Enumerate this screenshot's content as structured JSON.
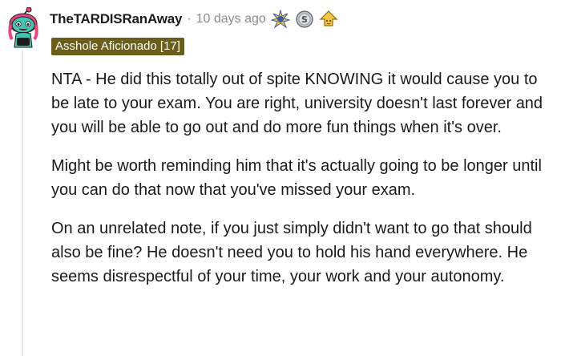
{
  "comment": {
    "username": "TheTARDISRanAway",
    "separator": "·",
    "timestamp": "10 days ago",
    "flair": "Asshole Aficionado [17]",
    "awards": [
      "sparkle-award-icon",
      "silver-award-icon",
      "helpful-award-icon"
    ],
    "paragraphs": [
      "NTA - He did this totally out of spite KNOWING it would cause you to be late to your exam. You are right, university doesn't last forever and you will be able to go out and do more fun things when it's over.",
      "Might be worth reminding him that it's actually going to be longer until you can do that now that you've missed your exam.",
      "On an unrelated note, if you just simply didn't want to go that should also be fine? He doesn't need you to hold his hand everywhere. He seems disrespectful of your time, your work and your autonomy."
    ]
  },
  "colors": {
    "flair_bg": "#6b5d1a",
    "avatar_skin": "#3fc7b4",
    "avatar_hair": "#e8467c",
    "meta_gray": "#878a8c"
  }
}
